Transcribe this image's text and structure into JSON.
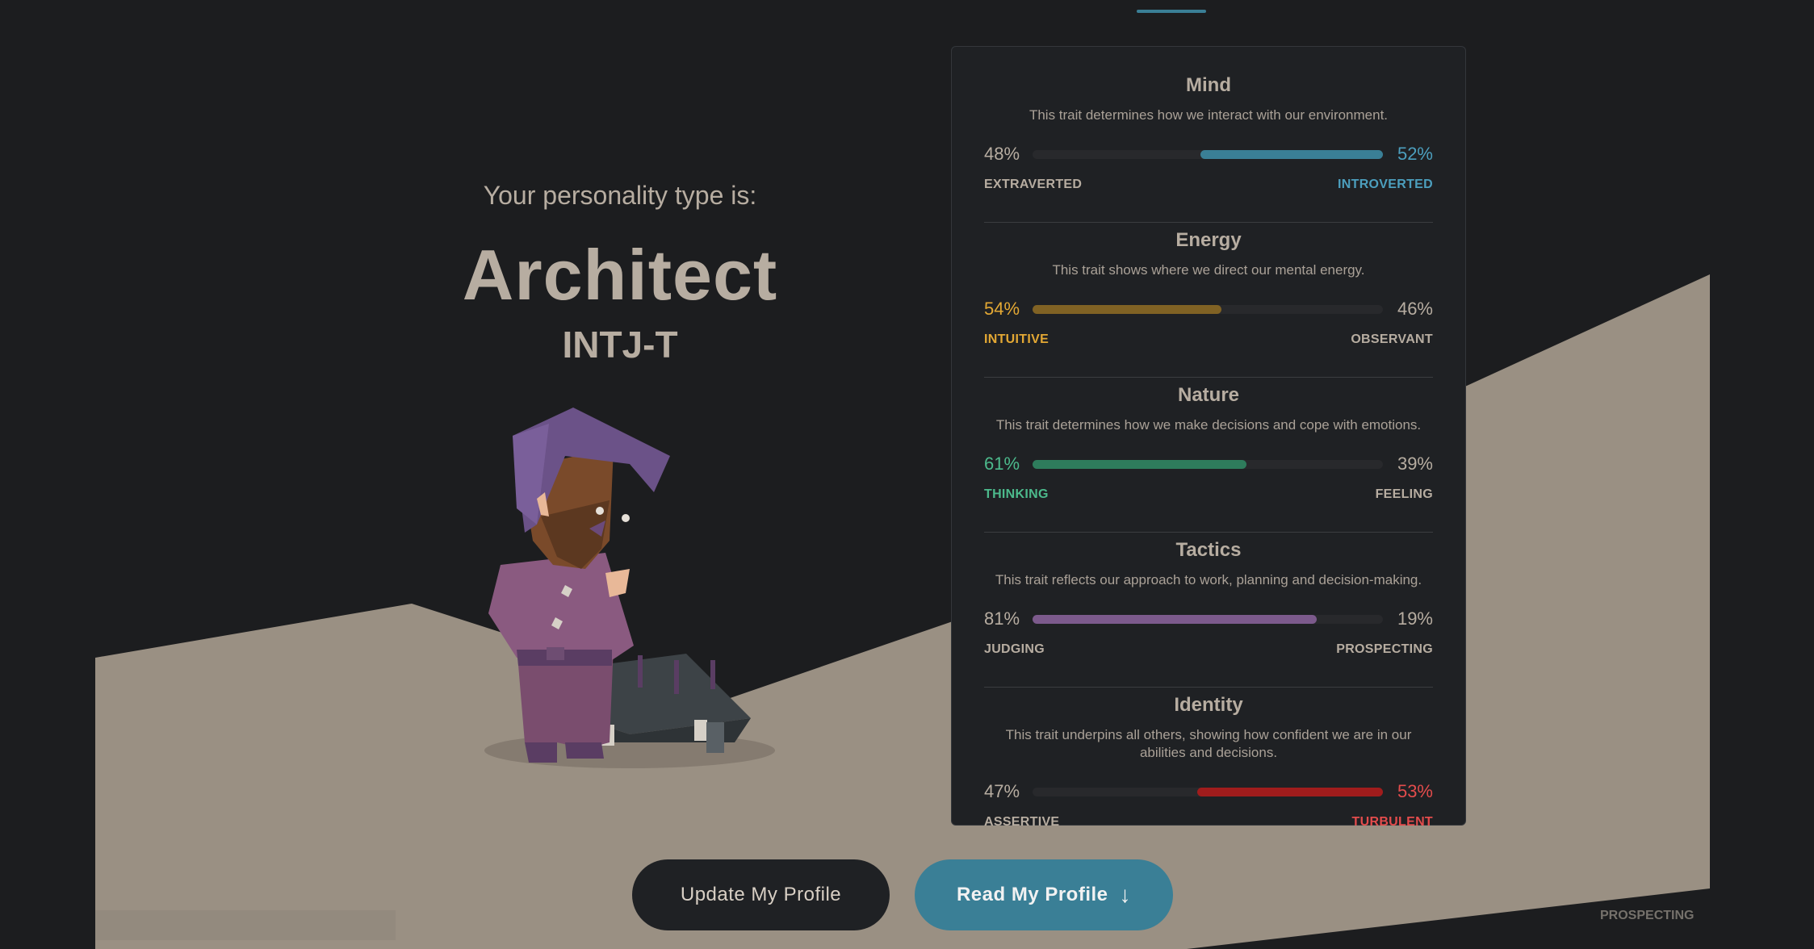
{
  "hero": {
    "intro": "Your personality type is:",
    "type_name": "Architect",
    "type_code": "INTJ-T"
  },
  "traits": [
    {
      "title": "Mind",
      "description": "This trait determines how we interact with our environment.",
      "left_pct": "48%",
      "right_pct": "52%",
      "left_label": "EXTRAVERTED",
      "right_label": "INTROVERTED",
      "dominant": "right",
      "value": 0.52,
      "color": "#3a7f96",
      "text_color": "#4c9fbe"
    },
    {
      "title": "Energy",
      "description": "This trait shows where we direct our mental energy.",
      "left_pct": "54%",
      "right_pct": "46%",
      "left_label": "INTUITIVE",
      "right_label": "OBSERVANT",
      "dominant": "left",
      "value": 0.54,
      "color": "#806224",
      "text_color": "#e3a834"
    },
    {
      "title": "Nature",
      "description": "This trait determines how we make decisions and cope with emotions.",
      "left_pct": "61%",
      "right_pct": "39%",
      "left_label": "THINKING",
      "right_label": "FEELING",
      "dominant": "left",
      "value": 0.61,
      "color": "#2e7c5c",
      "text_color": "#4cba8c"
    },
    {
      "title": "Tactics",
      "description": "This trait reflects our approach to work, planning and decision-making.",
      "left_pct": "81%",
      "right_pct": "19%",
      "left_label": "JUDGING",
      "right_label": "PROSPECTING",
      "dominant": "left",
      "value": 0.81,
      "color": "#7c5a8c",
      "text_color": "#b7ada1"
    },
    {
      "title": "Identity",
      "description": "This trait underpins all others, showing how confident we are in our abilities and decisions.",
      "left_pct": "47%",
      "right_pct": "53%",
      "left_label": "ASSERTIVE",
      "right_label": "TURBULENT",
      "dominant": "right",
      "value": 0.53,
      "color": "#a01c1c",
      "text_color": "#e34c4c"
    }
  ],
  "buttons": {
    "update": "Update My Profile",
    "read": "Read My Profile",
    "read_icon": "arrow-down-icon"
  },
  "background_ghost": {
    "label": "PROSPECTING"
  }
}
